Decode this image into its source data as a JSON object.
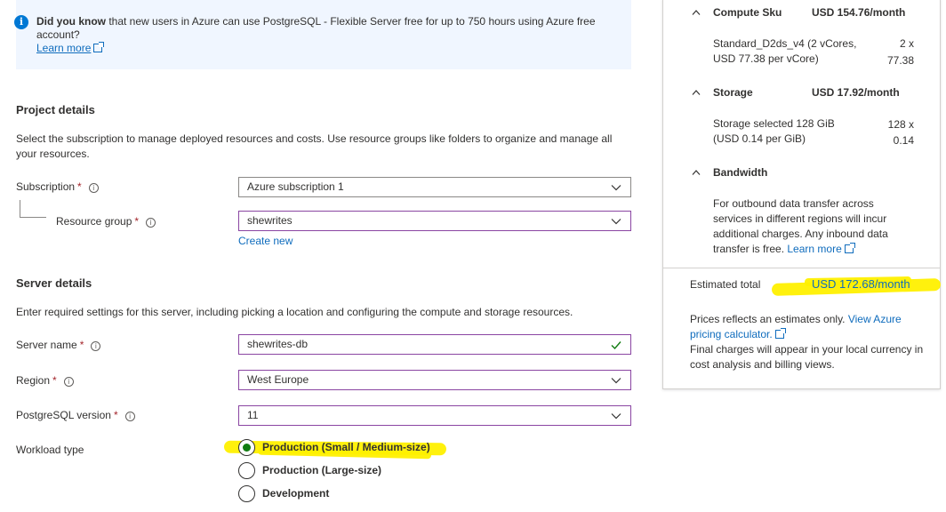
{
  "banner": {
    "lead": "Did you know",
    "text": " that new users in Azure can use PostgreSQL - Flexible Server free for up to 750 hours using Azure free account?",
    "link": "Learn more"
  },
  "project": {
    "title": "Project details",
    "description": "Select the subscription to manage deployed resources and costs. Use resource groups like folders to organize and manage all your resources.",
    "subscription_label": "Subscription",
    "subscription_value": "Azure subscription 1",
    "rg_label": "Resource group",
    "rg_value": "shewrites",
    "create_new": "Create new"
  },
  "server": {
    "title": "Server details",
    "description": "Enter required settings for this server, including picking a location and configuring the compute and storage resources.",
    "name_label": "Server name",
    "name_value": "shewrites-db",
    "region_label": "Region",
    "region_value": "West Europe",
    "version_label": "PostgreSQL version",
    "version_value": "11",
    "workload_label": "Workload type",
    "workload_options": [
      "Production (Small / Medium-size)",
      "Production (Large-size)",
      "Development"
    ],
    "workload_selected": 0
  },
  "required_mark": "*",
  "info_glyph": "i",
  "cost": {
    "compute_label": "Compute Sku",
    "compute_price": "USD 154.76/month",
    "compute_detail_line1": "Standard_D2ds_v4 (2 vCores,",
    "compute_detail_line2": "USD 77.38 per vCore)",
    "compute_qty_line1": "2 x",
    "compute_qty_line2": "77.38",
    "storage_label": "Storage",
    "storage_price": "USD 17.92/month",
    "storage_detail_line1": "Storage selected 128 GiB",
    "storage_detail_line2": "(USD 0.14 per GiB)",
    "storage_qty_line1": "128 x",
    "storage_qty_line2": "0.14",
    "bandwidth_label": "Bandwidth",
    "bandwidth_text": "For outbound data transfer across services in different regions will incur additional charges. Any inbound data transfer is free.",
    "bandwidth_link": "Learn more",
    "total_label": "Estimated total",
    "total_price": "USD 172.68/month",
    "note_text": "Prices reflects an estimates only. ",
    "note_link": "View Azure pricing calculator.",
    "note_text2": "Final charges will appear in your local currency in cost analysis and billing views."
  },
  "colors": {
    "accent": "#0f6cbd",
    "required": "#a4262c",
    "focus_border": "#8a45a2",
    "radio_selected": "#107c10",
    "highlight": "#fff000"
  }
}
